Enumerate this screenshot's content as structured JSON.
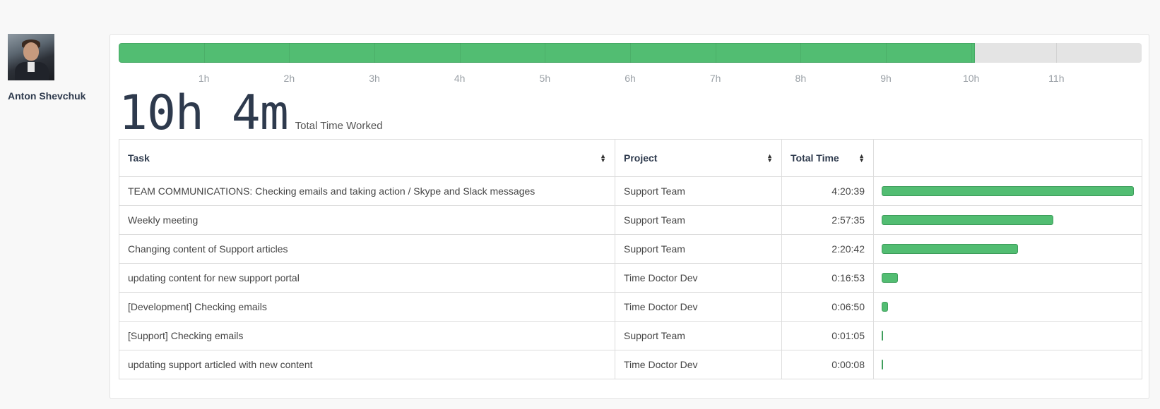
{
  "user": {
    "name": "Anton Shevchuk"
  },
  "timeline": {
    "worked_fraction_of_max": 0.8372,
    "max_hours": 12,
    "hour_labels": [
      "1h",
      "2h",
      "3h",
      "4h",
      "5h",
      "6h",
      "7h",
      "8h",
      "9h",
      "10h",
      "11h"
    ]
  },
  "summary": {
    "total_time": "10h 4m",
    "total_label": "Total Time Worked"
  },
  "table": {
    "headers": {
      "task": "Task",
      "project": "Project",
      "total_time": "Total Time"
    },
    "rows": [
      {
        "task": "TEAM COMMUNICATIONS: Checking emails and taking action / Skype and Slack messages",
        "project": "Support Team",
        "time": "4:20:39",
        "fraction": 1.0
      },
      {
        "task": "Weekly meeting",
        "project": "Support Team",
        "time": "2:57:35",
        "fraction": 0.681
      },
      {
        "task": "Changing content of Support articles",
        "project": "Support Team",
        "time": "2:20:42",
        "fraction": 0.54
      },
      {
        "task": "updating content for new support portal",
        "project": "Time Doctor Dev",
        "time": "0:16:53",
        "fraction": 0.065
      },
      {
        "task": "[Development] Checking emails",
        "project": "Time Doctor Dev",
        "time": "0:06:50",
        "fraction": 0.026
      },
      {
        "task": "[Support] Checking emails",
        "project": "Support Team",
        "time": "0:01:05",
        "fraction": 0.004
      },
      {
        "task": "updating support articled with new content",
        "project": "Time Doctor Dev",
        "time": "0:00:08",
        "fraction": 0.0005
      }
    ]
  },
  "colors": {
    "bar_green": "#52bd72",
    "title_navy": "#2e3a4d"
  }
}
